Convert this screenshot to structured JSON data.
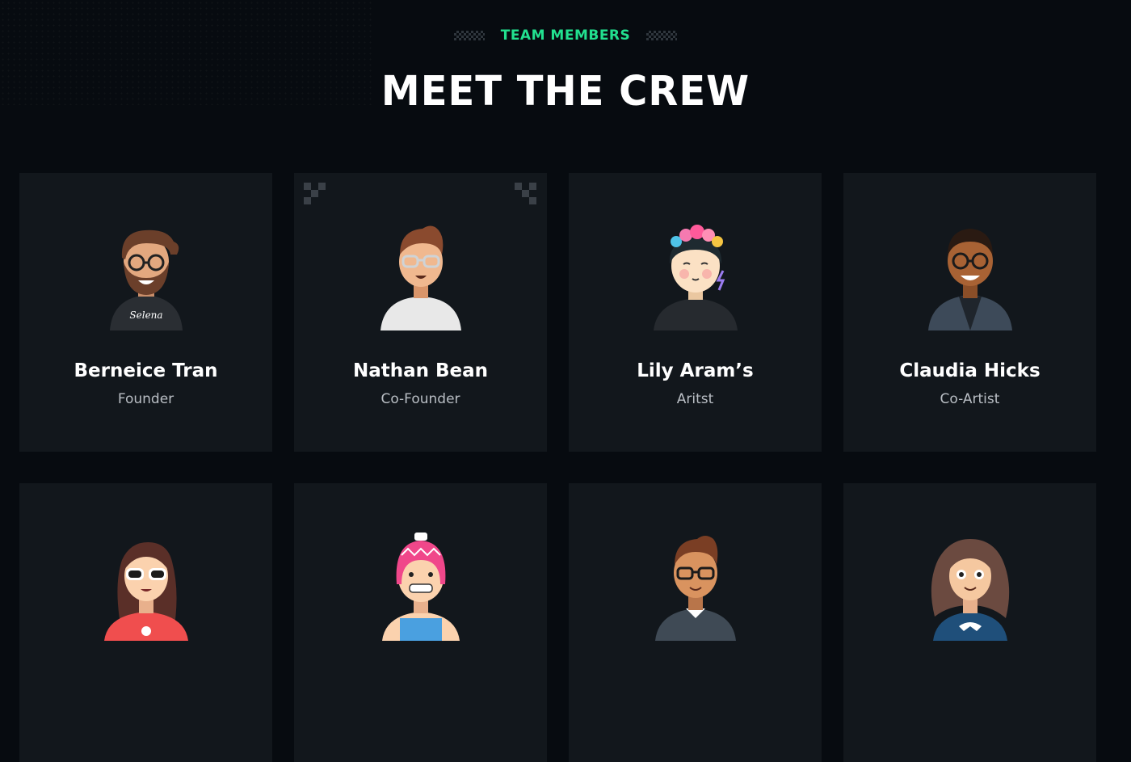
{
  "section": {
    "eyebrow": "TEAM MEMBERS",
    "title": "MEET THE CREW"
  },
  "colors": {
    "accent": "#22e08f",
    "background": "#070b10",
    "card": "#12171c"
  },
  "members": [
    {
      "name": "Berneice Tran",
      "role": "Founder",
      "avatar": "bearded-man-glasses-avatar"
    },
    {
      "name": "Nathan Bean",
      "role": "Co-Founder",
      "avatar": "man-glasses-avatar"
    },
    {
      "name": "Lily Aram’s",
      "role": "Aritst",
      "avatar": "woman-flower-crown-avatar"
    },
    {
      "name": "Claudia Hicks",
      "role": "Co-Artist",
      "avatar": "man-glasses-suit-avatar"
    },
    {
      "name": "",
      "role": "",
      "avatar": "woman-sunglasses-avatar"
    },
    {
      "name": "",
      "role": "",
      "avatar": "beanie-kid-avatar"
    },
    {
      "name": "",
      "role": "",
      "avatar": "man-glasses-sweater-avatar"
    },
    {
      "name": "",
      "role": "",
      "avatar": "curly-hair-woman-avatar"
    }
  ]
}
